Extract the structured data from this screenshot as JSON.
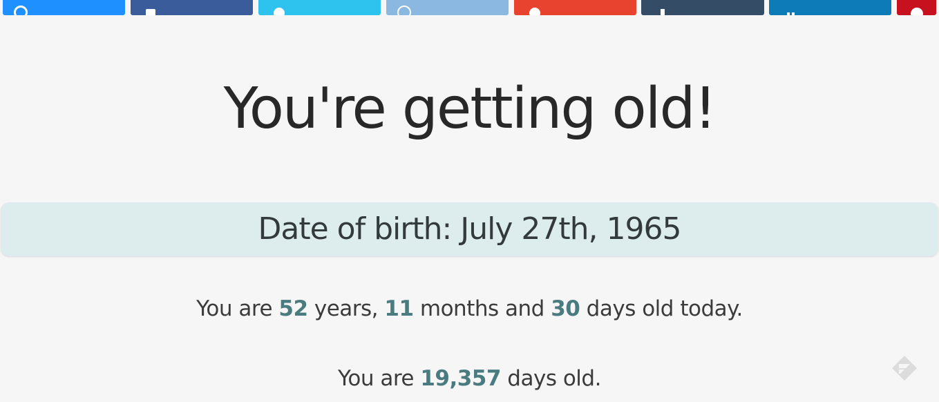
{
  "share_buttons": [
    {
      "name": "share-button-1",
      "icon": "c-icon",
      "color": "#1e90ff"
    },
    {
      "name": "share-button-facebook",
      "icon": "facebook-icon",
      "color": "#3b5c9a"
    },
    {
      "name": "share-button-twitter",
      "icon": "twitter-icon",
      "color": "#2ec3ee"
    },
    {
      "name": "share-button-4",
      "icon": "ring-icon",
      "color": "#8ab8e0"
    },
    {
      "name": "share-button-google-plus",
      "icon": "google-plus-icon",
      "color": "#e8432f"
    },
    {
      "name": "share-button-tumblr",
      "icon": "tumblr-icon",
      "color": "#344c66"
    },
    {
      "name": "share-button-linkedin",
      "icon": "linkedin-icon",
      "color": "#0c7bb8"
    },
    {
      "name": "share-button-pinterest",
      "icon": "pinterest-icon",
      "color": "#c8111e"
    }
  ],
  "title": "You're getting old!",
  "dob": {
    "text": "Date of birth: July 27th, 1965"
  },
  "age_breakdown": {
    "prefix": "You are ",
    "years": "52",
    "years_label": " years, ",
    "months": "11",
    "months_label": " months and ",
    "days": "30",
    "days_label": " days old today."
  },
  "total_days": {
    "prefix": "You are ",
    "days": "19,357",
    "suffix": " days old."
  },
  "colors": {
    "background": "#f6f6f6",
    "dob_panel": "#ddecec",
    "number_accent": "#4a7b7f"
  }
}
